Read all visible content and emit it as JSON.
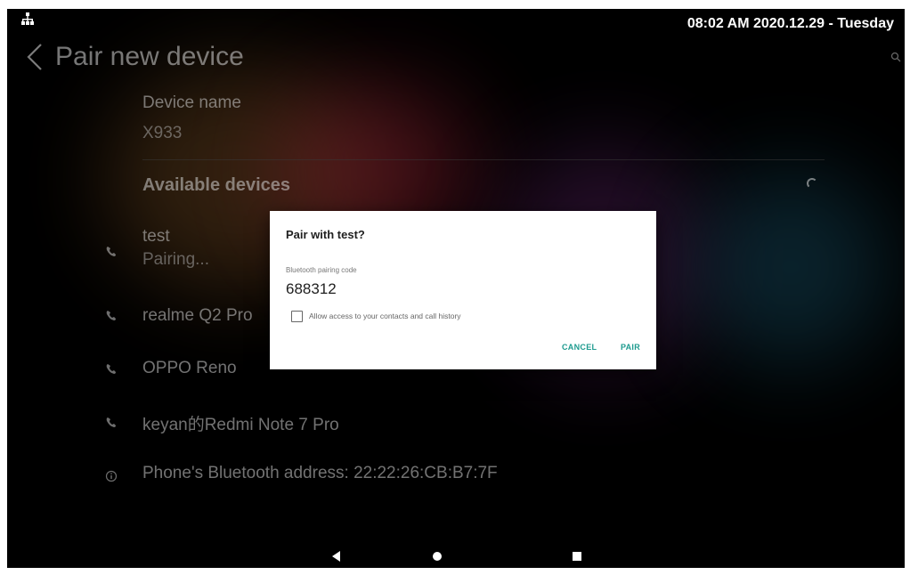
{
  "status_bar": {
    "time_date": "08:02 AM  2020.12.29 - Tuesday",
    "network_icon": "network-icon"
  },
  "header": {
    "title": "Pair new device",
    "back_icon": "chevron-left-icon",
    "search_icon": "search-icon"
  },
  "device": {
    "label": "Device name",
    "value": "X933"
  },
  "available": {
    "heading": "Available devices"
  },
  "devices": [
    {
      "name": "test",
      "status": "Pairing..."
    },
    {
      "name": "realme Q2 Pro"
    },
    {
      "name": "OPPO Reno"
    },
    {
      "name": "keyan的Redmi Note 7 Pro"
    }
  ],
  "address": {
    "text": "Phone's Bluetooth address: 22:22:26:CB:B7:7F"
  },
  "dialog": {
    "title": "Pair with test?",
    "code_label": "Bluetooth pairing code",
    "code": "688312",
    "checkbox_label": "Allow access to your contacts and call history",
    "checkbox_checked": false,
    "cancel": "CANCEL",
    "pair": "PAIR"
  },
  "colors": {
    "accent": "#1e9b8f",
    "background": "#000000"
  }
}
